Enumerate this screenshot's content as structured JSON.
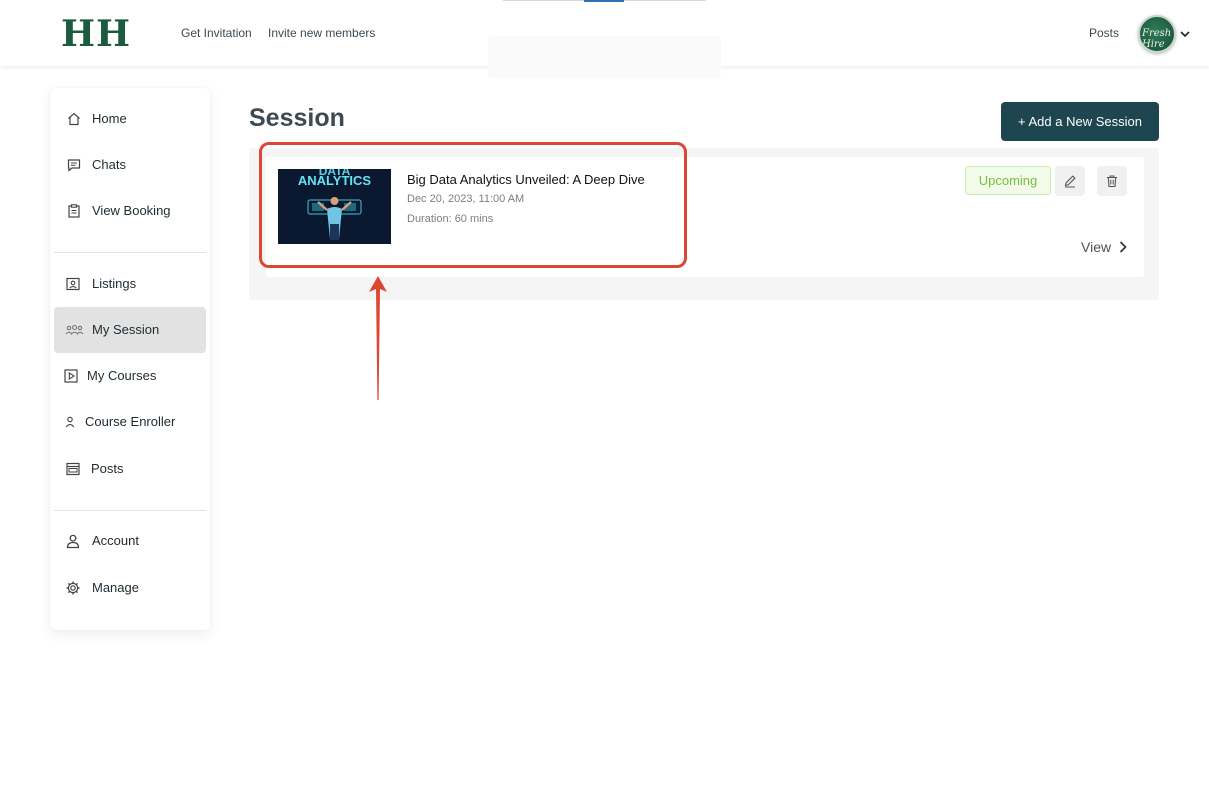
{
  "header": {
    "logo": "HH",
    "links": [
      "Get Invitation",
      "Invite new members"
    ],
    "posts_link": "Posts",
    "avatar_text": "Fresh Hire"
  },
  "sidebar": {
    "groups": [
      [
        {
          "label": "Home",
          "icon": "home-icon"
        },
        {
          "label": "Chats",
          "icon": "chat-icon"
        },
        {
          "label": "View Booking",
          "icon": "clipboard-icon"
        }
      ],
      [
        {
          "label": "Listings",
          "icon": "id-card-icon"
        },
        {
          "label": "My Session",
          "icon": "users-group-icon",
          "active": true
        },
        {
          "label": "My Courses",
          "icon": "play-square-icon"
        },
        {
          "label": "Course Enroller",
          "icon": "user-icon"
        },
        {
          "label": "Posts",
          "icon": "browser-window-icon"
        }
      ],
      [
        {
          "label": "Account",
          "icon": "account-icon"
        },
        {
          "label": "Manage",
          "icon": "gear-icon"
        }
      ]
    ]
  },
  "main": {
    "title": "Session",
    "add_button": "+ Add a New Session",
    "session": {
      "thumbnail_text": [
        "DATA",
        "ANALYTICS"
      ],
      "title": "Big Data Analytics Unveiled: A Deep Dive",
      "date": "Dec 20, 2023, 11:00 AM",
      "duration": "Duration: 60 mins",
      "status": "Upcoming",
      "view_label": "View"
    }
  },
  "colors": {
    "brand": "#1c5b41",
    "button": "#1e4651",
    "status_green": "#74c13f",
    "annotation_red": "#dc4735"
  }
}
